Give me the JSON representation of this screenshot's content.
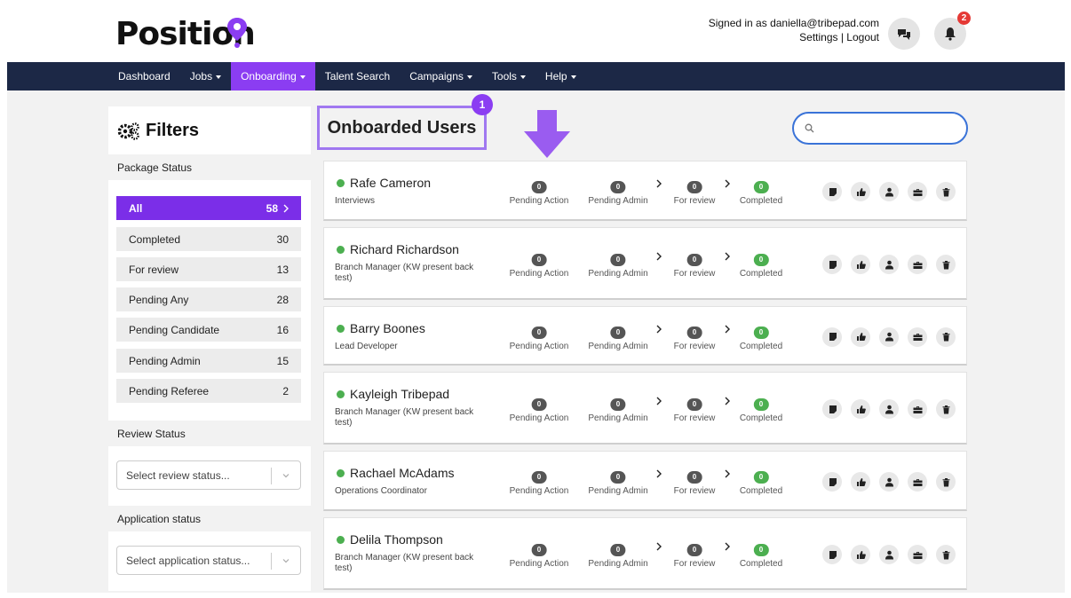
{
  "header": {
    "logo_text": "Position",
    "signed_in_text": "Signed in as daniella@tribepad.com",
    "settings_link": "Settings",
    "separator": " | ",
    "logout_link": "Logout",
    "notification_count": "2",
    "accent_color": "#8b3df2"
  },
  "nav": {
    "items": [
      {
        "label": "Dashboard",
        "caret": false
      },
      {
        "label": "Jobs",
        "caret": true
      },
      {
        "label": "Onboarding",
        "caret": true,
        "active": true
      },
      {
        "label": "Talent Search",
        "caret": false
      },
      {
        "label": "Campaigns",
        "caret": true
      },
      {
        "label": "Tools",
        "caret": true
      },
      {
        "label": "Help",
        "caret": true
      }
    ]
  },
  "sidebar": {
    "title": "Filters",
    "package_status_label": "Package Status",
    "package_items": [
      {
        "label": "All",
        "count": "58"
      },
      {
        "label": "Completed",
        "count": "30"
      },
      {
        "label": "For review",
        "count": "13"
      },
      {
        "label": "Pending Any",
        "count": "28"
      },
      {
        "label": "Pending Candidate",
        "count": "16"
      },
      {
        "label": "Pending Admin",
        "count": "15"
      },
      {
        "label": "Pending Referee",
        "count": "2"
      }
    ],
    "review_status_label": "Review Status",
    "review_status_placeholder": "Select review status...",
    "application_status_label": "Application status",
    "application_status_placeholder": "Select application status..."
  },
  "main": {
    "title": "Onboarded Users",
    "step_badge": "1",
    "search_placeholder": "",
    "stage_labels": [
      "Pending Action",
      "Pending Admin",
      "For review",
      "Completed"
    ],
    "candidates": [
      {
        "name": "Rafe Cameron",
        "role": "Interviews",
        "counts": [
          "0",
          "0",
          "0",
          "0"
        ]
      },
      {
        "name": "Richard Richardson",
        "role": "Branch Manager (KW present back test)",
        "counts": [
          "0",
          "0",
          "0",
          "0"
        ]
      },
      {
        "name": "Barry Boones",
        "role": "Lead Developer",
        "counts": [
          "0",
          "0",
          "0",
          "0"
        ]
      },
      {
        "name": "Kayleigh Tribepad",
        "role": "Branch Manager (KW present back test)",
        "counts": [
          "0",
          "0",
          "0",
          "0"
        ]
      },
      {
        "name": "Rachael McAdams",
        "role": "Operations Coordinator",
        "counts": [
          "0",
          "0",
          "0",
          "0"
        ]
      },
      {
        "name": "Delila Thompson",
        "role": "Branch Manager (KW present back test)",
        "counts": [
          "0",
          "0",
          "0",
          "0"
        ]
      }
    ],
    "action_icons": [
      "note-icon",
      "thumbs-up-icon",
      "user-icon",
      "briefcase-icon",
      "trash-icon"
    ]
  }
}
